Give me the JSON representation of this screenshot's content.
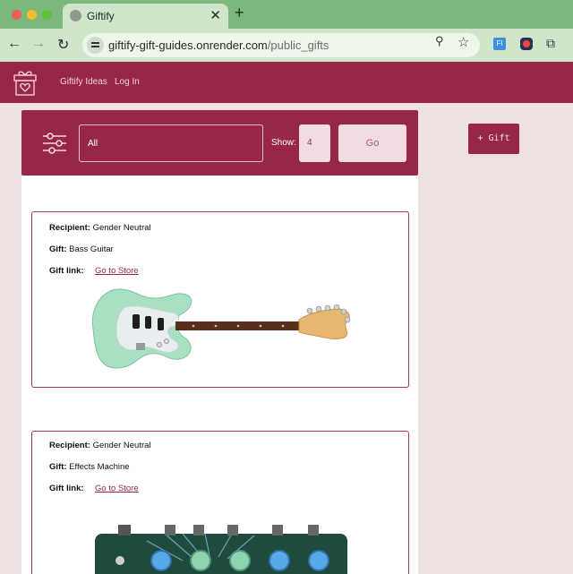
{
  "browser": {
    "tab_title": "Giftify",
    "url_host": "giftify-gift-guides.onrender.com",
    "url_path": "/public_gifts",
    "new_tab_glyph": "+",
    "close_glyph": "✕",
    "back_glyph": "←",
    "forward_glyph": "→",
    "reload_glyph": "↻",
    "star_glyph": "☆",
    "zoom_glyph": "⚲",
    "ext_glyph": "⧉",
    "ext1_label": "FI"
  },
  "nav": {
    "ideas": "Giftify Ideas",
    "login": "Log In"
  },
  "filters": {
    "category": "All",
    "show_label": "Show:",
    "show_value": "4",
    "go_label": "Go"
  },
  "add_gift_label": "+ Gift",
  "gifts": [
    {
      "recipient_label": "Recipient:",
      "recipient": "Gender Neutral",
      "gift_label": "Gift:",
      "gift": "Bass Guitar",
      "link_label": "Gift link:",
      "link_text": "Go to Store",
      "image_icon": "bass-guitar-image"
    },
    {
      "recipient_label": "Recipient:",
      "recipient": "Gender Neutral",
      "gift_label": "Gift:",
      "gift": "Effects Machine",
      "link_label": "Gift link:",
      "link_text": "Go to Store",
      "image_icon": "effects-pedal-image"
    }
  ],
  "colors": {
    "brand": "#972648",
    "page_bg": "#efe0e1",
    "chrome_green": "#7bb87c"
  }
}
